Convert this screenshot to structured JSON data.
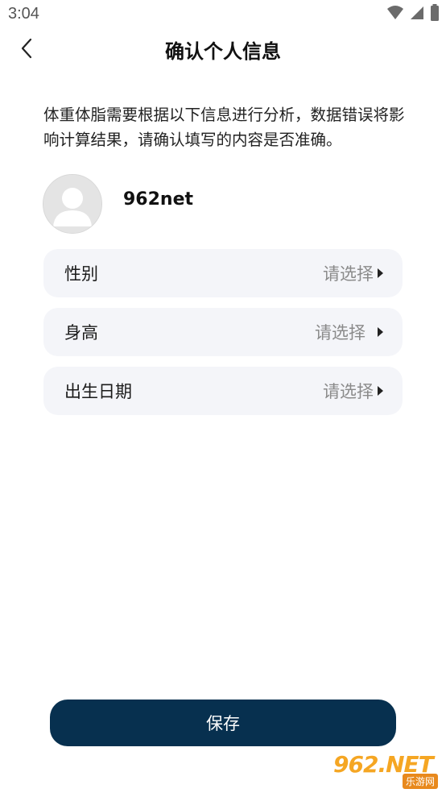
{
  "status_bar": {
    "time": "3:04"
  },
  "header": {
    "title": "确认个人信息",
    "back_icon": "chevron-left-icon"
  },
  "intro": {
    "text": "体重体脂需要根据以下信息进行分析，数据错误将影响计算结果，请确认填写的内容是否准确。"
  },
  "profile": {
    "username": "962net",
    "avatar_icon": "default-avatar-icon"
  },
  "form": {
    "rows": [
      {
        "label": "性别",
        "value": "请选择"
      },
      {
        "label": "身高",
        "value": "请选择"
      },
      {
        "label": "出生日期",
        "value": "请选择"
      }
    ]
  },
  "actions": {
    "save_label": "保存"
  },
  "watermark": {
    "logo_text": "962.NET",
    "sub_text": "乐游网"
  },
  "colors": {
    "primary": "#07304f",
    "row_background": "#f4f5f9",
    "placeholder": "#8a8a8a"
  }
}
